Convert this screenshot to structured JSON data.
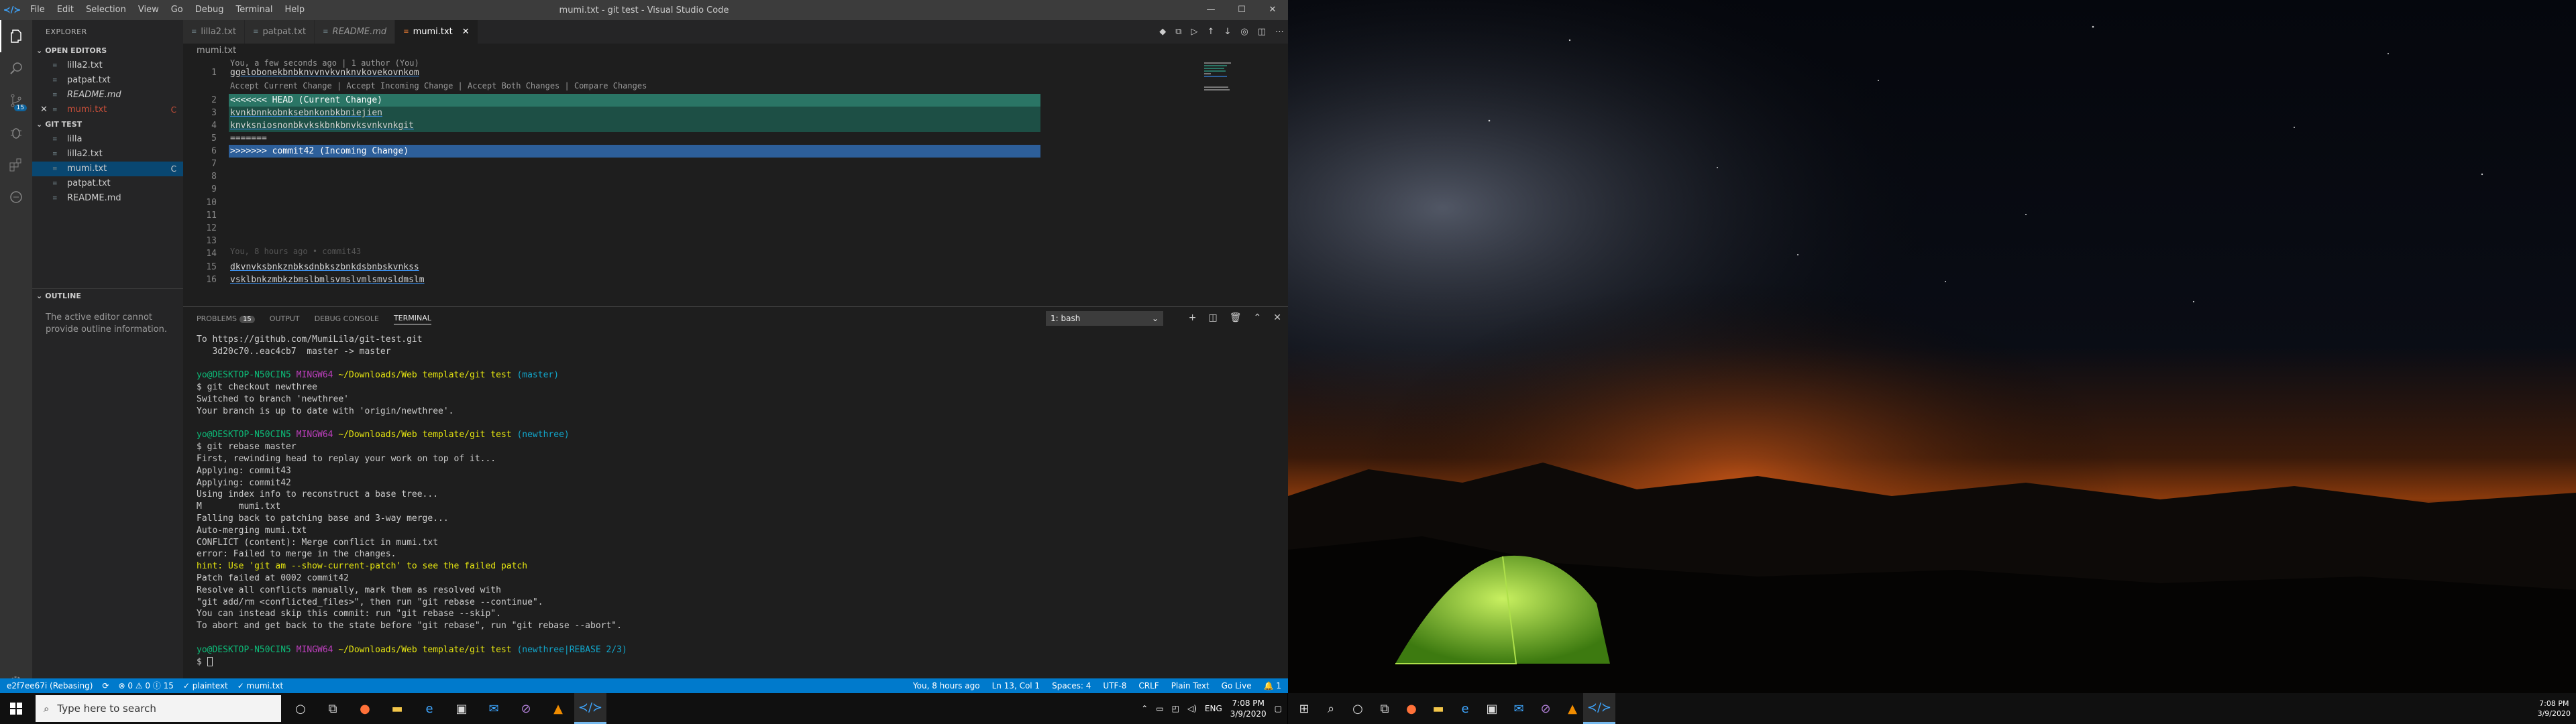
{
  "window": {
    "title": "mumi.txt - git test - Visual Studio Code",
    "menu": [
      "File",
      "Edit",
      "Selection",
      "View",
      "Go",
      "Debug",
      "Terminal",
      "Help"
    ],
    "controls": {
      "minimize": "—",
      "maximize": "☐",
      "close": "✕"
    }
  },
  "activity_bar": {
    "items": [
      "explorer-icon",
      "search-icon",
      "source-control-icon",
      "debug-icon",
      "extensions-icon",
      "remote-icon"
    ],
    "scm_badge": "15"
  },
  "sidebar": {
    "title": "EXPLORER",
    "open_editors_label": "OPEN EDITORS",
    "open_editors": [
      {
        "name": "lilla2.txt",
        "status": ""
      },
      {
        "name": "patpat.txt",
        "status": ""
      },
      {
        "name": "README.md",
        "status": ""
      },
      {
        "name": "mumi.txt",
        "status": "C"
      }
    ],
    "folder_label": "GIT TEST",
    "files": [
      {
        "name": "lilla",
        "status": ""
      },
      {
        "name": "lilla2.txt",
        "status": ""
      },
      {
        "name": "mumi.txt",
        "status": "C"
      },
      {
        "name": "patpat.txt",
        "status": ""
      },
      {
        "name": "README.md",
        "status": ""
      }
    ],
    "outline_label": "OUTLINE",
    "outline_text": "The active editor cannot provide outline information."
  },
  "tabs": [
    {
      "label": "lilla2.txt"
    },
    {
      "label": "patpat.txt"
    },
    {
      "label": "README.md"
    },
    {
      "label": "mumi.txt"
    }
  ],
  "breadcrumb": "mumi.txt",
  "editor": {
    "codelens_top": "You, a few seconds ago | 1 author (You)",
    "merge_actions": "Accept Current Change | Accept Incoming Change | Accept Both Changes | Compare Changes",
    "lines": [
      {
        "n": "1",
        "text": "ggelobonekbnbknvvnvkvnknvkovekovnkom"
      },
      {
        "n": "2",
        "text": "<<<<<<< HEAD (Current Change)"
      },
      {
        "n": "3",
        "text": "kvnkbnnkobnksebnkonbkbniejien"
      },
      {
        "n": "4",
        "text": "knvksniosnonbkvkskbnkbnvksvnkvnkgit"
      },
      {
        "n": "5",
        "text": "======="
      },
      {
        "n": "6",
        "text": ">>>>>>> commit42 (Incoming Change)"
      },
      {
        "n": "7",
        "text": ""
      },
      {
        "n": "8",
        "text": ""
      },
      {
        "n": "9",
        "text": ""
      },
      {
        "n": "10",
        "text": ""
      },
      {
        "n": "11",
        "text": ""
      },
      {
        "n": "12",
        "text": ""
      },
      {
        "n": "13",
        "text": ""
      },
      {
        "n": "14",
        "text": ""
      },
      {
        "n": "15",
        "text": "dkvnvksbnkznbksdnbkszbnkdsbnbskvnkss"
      },
      {
        "n": "16",
        "text": "vsklbnkzmbkzbmslbmlsvmslvmlsmvsldmslm"
      }
    ],
    "blame_13": "You, 8 hours ago • commit43"
  },
  "panel": {
    "tabs": [
      "PROBLEMS",
      "OUTPUT",
      "DEBUG CONSOLE",
      "TERMINAL"
    ],
    "problems_count": "15",
    "terminal_select": "1: bash",
    "terminal_lines": [
      {
        "t": "plain",
        "v": "To https://github.com/MumiLila/git-test.git"
      },
      {
        "t": "plain",
        "v": "   3d20c70..eac4cb7  master -> master"
      },
      {
        "t": "plain",
        "v": ""
      },
      {
        "t": "prompt",
        "user": "yo@DESKTOP-N50CIN5",
        "sys": "MINGW64",
        "path": "~/Downloads/Web template/git test",
        "branch": "(master)"
      },
      {
        "t": "plain",
        "v": "$ git checkout newthree"
      },
      {
        "t": "plain",
        "v": "Switched to branch 'newthree'"
      },
      {
        "t": "plain",
        "v": "Your branch is up to date with 'origin/newthree'."
      },
      {
        "t": "plain",
        "v": ""
      },
      {
        "t": "prompt",
        "user": "yo@DESKTOP-N50CIN5",
        "sys": "MINGW64",
        "path": "~/Downloads/Web template/git test",
        "branch": "(newthree)"
      },
      {
        "t": "plain",
        "v": "$ git rebase master"
      },
      {
        "t": "plain",
        "v": "First, rewinding head to replay your work on top of it..."
      },
      {
        "t": "plain",
        "v": "Applying: commit43"
      },
      {
        "t": "plain",
        "v": "Applying: commit42"
      },
      {
        "t": "plain",
        "v": "Using index info to reconstruct a base tree..."
      },
      {
        "t": "plain",
        "v": "M       mumi.txt"
      },
      {
        "t": "plain",
        "v": "Falling back to patching base and 3-way merge..."
      },
      {
        "t": "plain",
        "v": "Auto-merging mumi.txt"
      },
      {
        "t": "plain",
        "v": "CONFLICT (content): Merge conflict in mumi.txt"
      },
      {
        "t": "plain",
        "v": "error: Failed to merge in the changes."
      },
      {
        "t": "hint",
        "v": "hint: Use 'git am --show-current-patch' to see the failed patch"
      },
      {
        "t": "plain",
        "v": "Patch failed at 0002 commit42"
      },
      {
        "t": "plain",
        "v": "Resolve all conflicts manually, mark them as resolved with"
      },
      {
        "t": "plain",
        "v": "\"git add/rm <conflicted_files>\", then run \"git rebase --continue\"."
      },
      {
        "t": "plain",
        "v": "You can instead skip this commit: run \"git rebase --skip\"."
      },
      {
        "t": "plain",
        "v": "To abort and get back to the state before \"git rebase\", run \"git rebase --abort\"."
      },
      {
        "t": "plain",
        "v": ""
      },
      {
        "t": "prompt",
        "user": "yo@DESKTOP-N50CIN5",
        "sys": "MINGW64",
        "path": "~/Downloads/Web template/git test",
        "branch": "(newthree|REBASE 2/3)"
      },
      {
        "t": "plain",
        "v": "$ "
      }
    ]
  },
  "statusbar": {
    "left": [
      "e2f7ee67i (Rebasing)",
      "⟳",
      "⊗ 0 ⚠ 0 ⓘ 15",
      "✓ plaintext",
      "✓ mumi.txt"
    ],
    "right": [
      "You, 8 hours ago",
      "Ln 13, Col 1",
      "Spaces: 4",
      "UTF-8",
      "CRLF",
      "Plain Text",
      "Go Live",
      "🔔 1"
    ]
  },
  "taskbar": {
    "search_placeholder": "Type here to search",
    "apps": [
      "cortana-icon",
      "task-view-icon",
      "firefox-icon",
      "file-explorer-icon",
      "edge-icon",
      "store-icon",
      "mail-icon",
      "vs-icon",
      "vlc-icon",
      "vscode-icon"
    ],
    "language": "ENG",
    "time": "7:08 PM",
    "date": "3/9/2020"
  },
  "colors": {
    "accent": "#007acc",
    "current_change": "#2a7565",
    "incoming_change": "#2d5f9a"
  }
}
